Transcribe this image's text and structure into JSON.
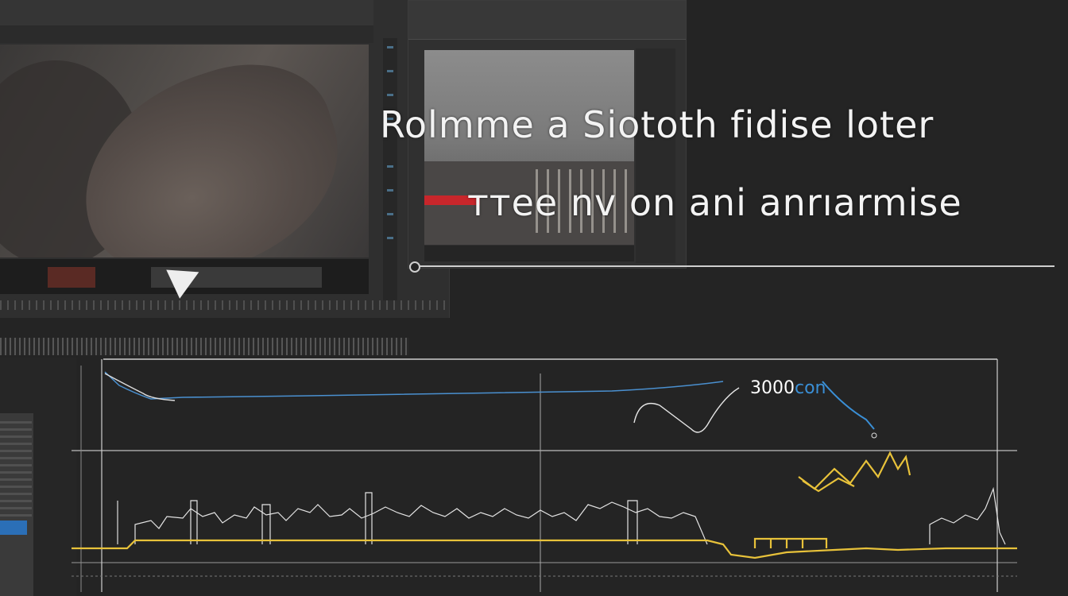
{
  "overlay": {
    "line1": "Rolmme a  Siototh fidise loter",
    "line2": "ттее nv on  ani  anrıarmise"
  },
  "graph": {
    "readout_white": "3000",
    "readout_blue": "con"
  },
  "colors": {
    "background": "#242424",
    "accent_blue": "#2b6fb7",
    "waveform_yellow": "#e8c23a",
    "clip_red": "#c8262b"
  },
  "icons": {
    "play": "play-icon",
    "playhead": "playhead-knob-icon"
  }
}
